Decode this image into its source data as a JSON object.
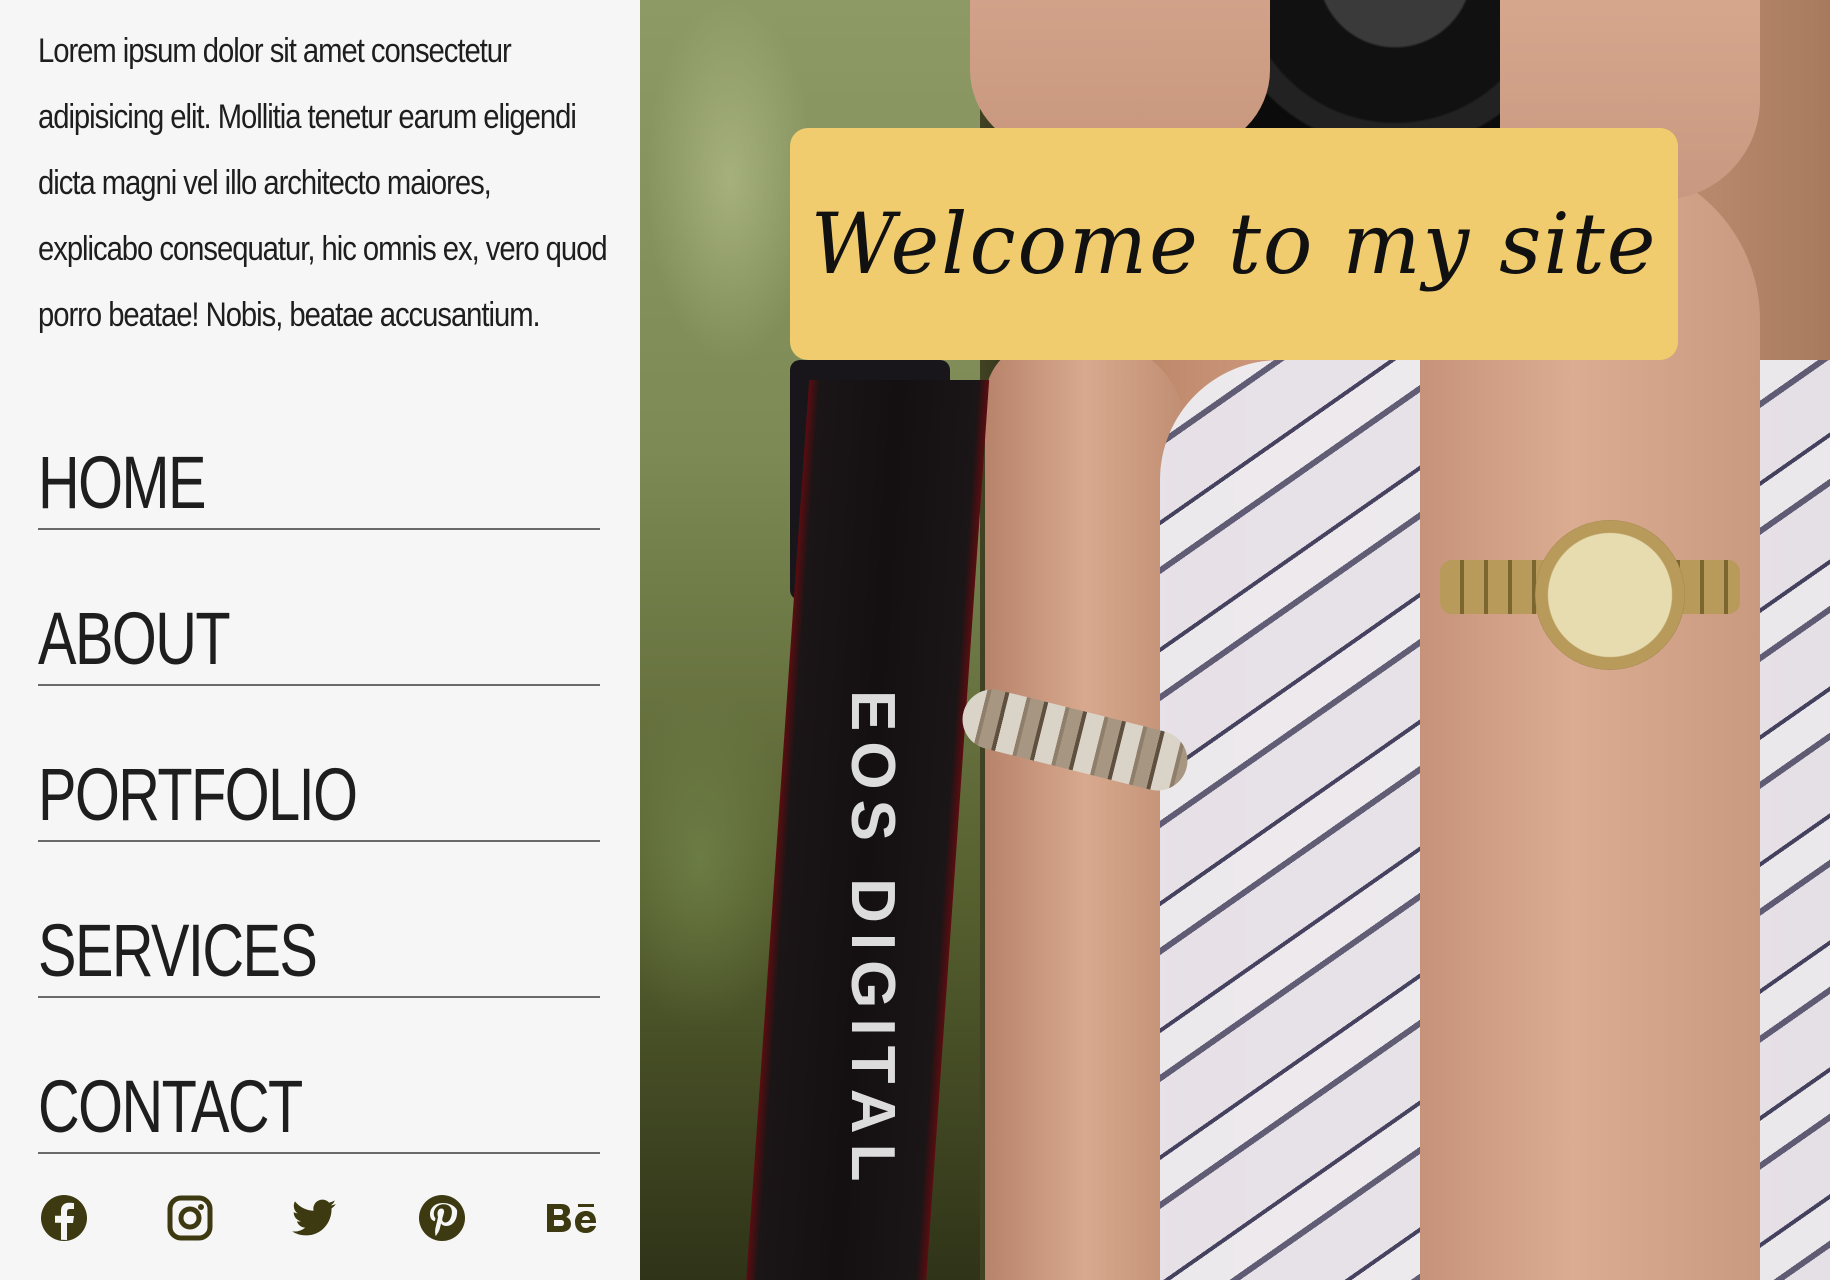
{
  "sidebar": {
    "intro": "Lorem ipsum dolor sit amet consectetur adipisicing elit. Mollitia tenetur earum eligendi dicta magni vel illo architecto maiores, explicabo consequatur, hic omnis ex, vero quod porro beatae! Nobis, beatae accusantium.",
    "nav": [
      {
        "label": "HOME"
      },
      {
        "label": "ABOUT"
      },
      {
        "label": "PORTFOLIO"
      },
      {
        "label": "SERVICES"
      },
      {
        "label": "CONTACT"
      }
    ],
    "socials": [
      {
        "icon": "facebook-icon"
      },
      {
        "icon": "instagram-icon"
      },
      {
        "icon": "twitter-icon"
      },
      {
        "icon": "pinterest-icon"
      },
      {
        "icon": "behance-icon"
      }
    ]
  },
  "hero": {
    "welcome": "Welcome to my site",
    "strap_text": "EOS DIGITAL"
  },
  "colors": {
    "sidebar_bg": "#f6f6f6",
    "text": "#1e1e1e",
    "welcome_bg": "#f0cc6e",
    "social_icon": "#3d3a12"
  }
}
